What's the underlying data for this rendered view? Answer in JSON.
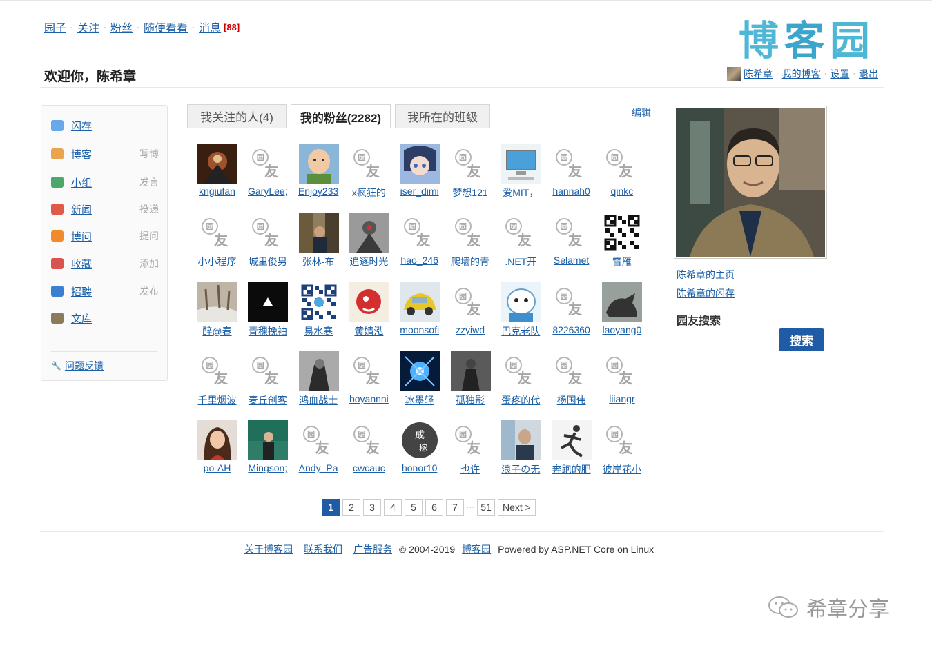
{
  "top_nav": {
    "items": [
      "园子",
      "关注",
      "粉丝",
      "随便看看",
      "消息"
    ],
    "msg_count": "[88]"
  },
  "logo": {
    "chars": [
      "博",
      "客",
      "园"
    ]
  },
  "welcome": "欢迎你，陈希章",
  "user_nav": [
    "陈希章",
    "我的博客",
    "设置",
    "退出"
  ],
  "sidebar": {
    "items": [
      {
        "label": "闪存",
        "sub": "",
        "icon": "chat-bubble-icon",
        "color": "#6aa9e9"
      },
      {
        "label": "博客",
        "sub": "写博",
        "icon": "pencil-note-icon",
        "color": "#e9a44e"
      },
      {
        "label": "小组",
        "sub": "发言",
        "icon": "people-icon",
        "color": "#4ca86a"
      },
      {
        "label": "新闻",
        "sub": "投递",
        "icon": "news-icon",
        "color": "#e05a4a"
      },
      {
        "label": "博问",
        "sub": "提问",
        "icon": "question-icon",
        "color": "#f08a2a"
      },
      {
        "label": "收藏",
        "sub": "添加",
        "icon": "favorite-icon",
        "color": "#d9534f"
      },
      {
        "label": "招聘",
        "sub": "发布",
        "icon": "jobs-icon",
        "color": "#3b7fd1"
      },
      {
        "label": "文库",
        "sub": "",
        "icon": "book-icon",
        "color": "#8c7b5a"
      }
    ],
    "feedback": "问题反馈"
  },
  "tabs": [
    "我关注的人(4)",
    "我的粉丝(2282)",
    "我所在的班级"
  ],
  "edit_label": "编辑",
  "fans": [
    {
      "name": "kngiufan",
      "av": "dark-art"
    },
    {
      "name": "GaryLee;",
      "av": "default"
    },
    {
      "name": "Enjoy233",
      "av": "baby"
    },
    {
      "name": "x疯狂的",
      "av": "default"
    },
    {
      "name": "iser_dimi",
      "av": "anime"
    },
    {
      "name": "梦想121",
      "av": "default"
    },
    {
      "name": "爱MIT，",
      "av": "computer"
    },
    {
      "name": "hannah0",
      "av": "default"
    },
    {
      "name": "qinkc",
      "av": "default"
    },
    {
      "name": "小小程序",
      "av": "default"
    },
    {
      "name": "城里俊男",
      "av": "default"
    },
    {
      "name": "张林-布",
      "av": "room"
    },
    {
      "name": "追逐时光",
      "av": "dark-gray"
    },
    {
      "name": "hao_246",
      "av": "default"
    },
    {
      "name": "爬墙的青",
      "av": "default"
    },
    {
      "name": ".NET开",
      "av": "default"
    },
    {
      "name": "Selamet",
      "av": "default"
    },
    {
      "name": "雪雁",
      "av": "qr"
    },
    {
      "name": "醉@春",
      "av": "snow"
    },
    {
      "name": "青稞挽袖",
      "av": "black-logo"
    },
    {
      "name": "易水寒",
      "av": "qr-blue"
    },
    {
      "name": "黄婧泓",
      "av": "red-cartoon"
    },
    {
      "name": "moonsofi",
      "av": "yellow-car"
    },
    {
      "name": "zzyiwd",
      "av": "default"
    },
    {
      "name": "巴克老队",
      "av": "bear"
    },
    {
      "name": "8226360",
      "av": "default"
    },
    {
      "name": "laoyang0",
      "av": "dino"
    },
    {
      "name": "千里烟波",
      "av": "default"
    },
    {
      "name": "麦丘创客",
      "av": "default"
    },
    {
      "name": "鸿血战士",
      "av": "warrior"
    },
    {
      "name": "boyannni",
      "av": "default"
    },
    {
      "name": "冰墨轻",
      "av": "blue-burst"
    },
    {
      "name": "孤独影",
      "av": "dark-figure"
    },
    {
      "name": "蛋疼的代",
      "av": "default"
    },
    {
      "name": "杨国伟",
      "av": "default"
    },
    {
      "name": "liiangr",
      "av": "default"
    },
    {
      "name": "po-AH",
      "av": "woman"
    },
    {
      "name": "Mingson;",
      "av": "speaker"
    },
    {
      "name": "Andy_Pa",
      "av": "default"
    },
    {
      "name": "cwcauc",
      "av": "default"
    },
    {
      "name": "honor10",
      "av": "circle-logo"
    },
    {
      "name": "也许",
      "av": "default"
    },
    {
      "name": "浪子の无",
      "av": "man"
    },
    {
      "name": "奔跑的肥",
      "av": "runner"
    },
    {
      "name": "彼岸花小",
      "av": "default"
    }
  ],
  "pager": {
    "pages": [
      "1",
      "2",
      "3",
      "4",
      "5",
      "6",
      "7"
    ],
    "dots": "···",
    "last": "51",
    "next": "Next >"
  },
  "footer": {
    "links": [
      "关于博客园",
      "联系我们",
      "广告服务"
    ],
    "copyright": "© 2004-2019",
    "site": "博客园",
    "powered": "Powered by ASP.NET Core on Linux"
  },
  "profile": {
    "home_link": "陈希章的主页",
    "ing_link": "陈希章的闪存"
  },
  "search": {
    "title": "园友搜索",
    "button": "搜索",
    "value": ""
  },
  "watermark": "希章分享",
  "default_avatar": {
    "c1": "园",
    "c2": "友"
  },
  "colors": {
    "link": "#1a5fa8",
    "accent": "#1f5ca5",
    "badge": "#cc0000"
  }
}
